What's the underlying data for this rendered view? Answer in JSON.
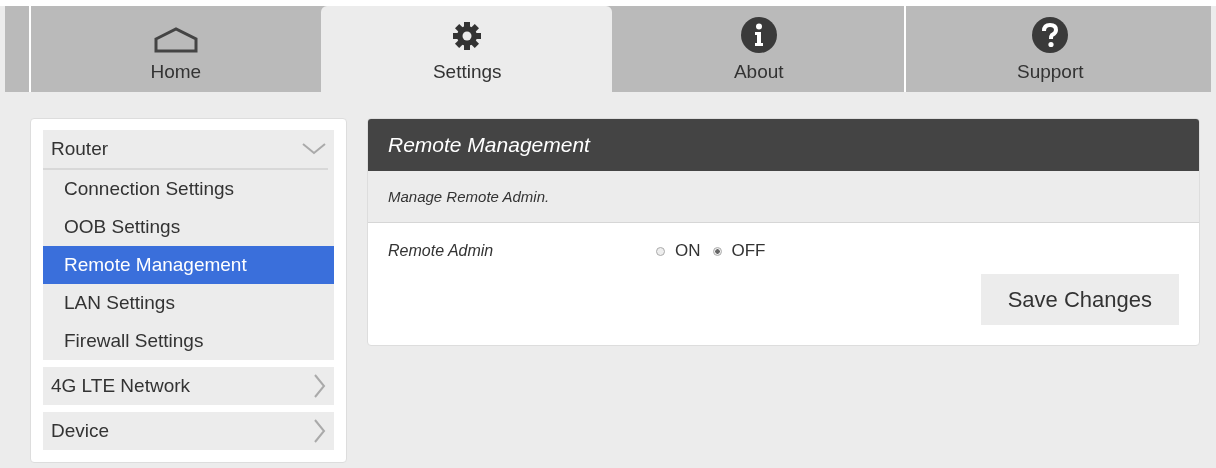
{
  "tabs": [
    {
      "label": "Home",
      "kind": "home",
      "selected": false
    },
    {
      "label": "Settings",
      "kind": "settings",
      "selected": true
    },
    {
      "label": "About",
      "kind": "about",
      "selected": false
    },
    {
      "label": "Support",
      "kind": "support",
      "selected": false
    }
  ],
  "sidebar": {
    "groups": [
      {
        "label": "Router",
        "expanded": true,
        "items": [
          {
            "label": "Connection Settings",
            "selected": false
          },
          {
            "label": "OOB Settings",
            "selected": false
          },
          {
            "label": "Remote Management",
            "selected": true
          },
          {
            "label": "LAN Settings",
            "selected": false
          },
          {
            "label": "Firewall Settings",
            "selected": false
          }
        ]
      },
      {
        "label": "4G LTE Network",
        "expanded": false
      },
      {
        "label": "Device",
        "expanded": false
      }
    ]
  },
  "panel": {
    "title": "Remote Management",
    "description": "Manage Remote Admin.",
    "field": {
      "label": "Remote Admin",
      "options": [
        {
          "label": "ON",
          "selected": false
        },
        {
          "label": "OFF",
          "selected": true
        }
      ]
    },
    "save_button": "Save Changes"
  }
}
